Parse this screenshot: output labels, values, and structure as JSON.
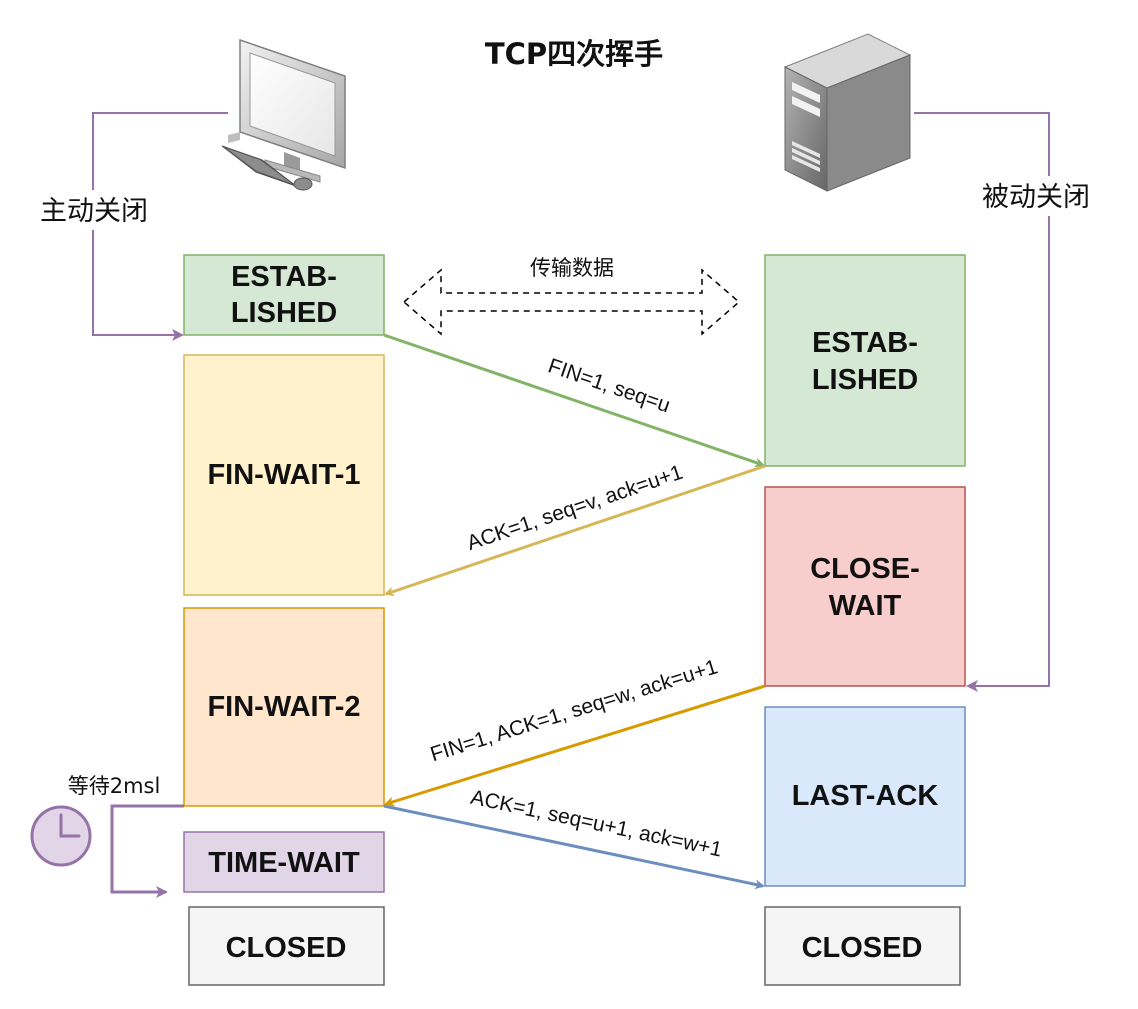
{
  "title": "TCP四次挥手",
  "left_side": {
    "label": "主动关闭",
    "icon": "desktop-computer-icon",
    "states": [
      {
        "id": "l-established",
        "line1": "ESTAB-",
        "line2": "LISHED",
        "fill": "#d5e8d4",
        "stroke": "#82b366"
      },
      {
        "id": "l-fin-wait-1",
        "line1": "FIN-WAIT-1",
        "fill": "#fff2cc",
        "stroke": "#d6b656"
      },
      {
        "id": "l-fin-wait-2",
        "line1": "FIN-WAIT-2",
        "fill": "#ffe6cc",
        "stroke": "#d79b00"
      },
      {
        "id": "l-time-wait",
        "line1": "TIME-WAIT",
        "fill": "#e1d5e7",
        "stroke": "#9673a6"
      },
      {
        "id": "l-closed",
        "line1": "CLOSED",
        "fill": "#f5f5f5",
        "stroke": "#666666"
      }
    ],
    "wait_label": "等待2msl",
    "wait_icon": "clock-icon"
  },
  "right_side": {
    "label": "被动关闭",
    "icon": "server-tower-icon",
    "states": [
      {
        "id": "r-established",
        "line1": "ESTAB-",
        "line2": "LISHED",
        "fill": "#d5e8d4",
        "stroke": "#82b366"
      },
      {
        "id": "r-close-wait",
        "line1": "CLOSE-",
        "line2": "WAIT",
        "fill": "#f8cecc",
        "stroke": "#b85450"
      },
      {
        "id": "r-last-ack",
        "line1": "LAST-ACK",
        "fill": "#dae8fc",
        "stroke": "#6c8ebf"
      },
      {
        "id": "r-closed",
        "line1": "CLOSED",
        "fill": "#f5f5f5",
        "stroke": "#666666"
      }
    ]
  },
  "data_transfer_label": "传输数据",
  "messages": [
    {
      "id": "msg-fin-1",
      "label": "FIN=1, seq=u",
      "color": "#82b366"
    },
    {
      "id": "msg-ack-1",
      "label": "ACK=1, seq=v, ack=u+1",
      "color": "#d6b656"
    },
    {
      "id": "msg-fin-2",
      "label": "FIN=1, ACK=1, seq=w, ack=u+1",
      "color": "#d79b00"
    },
    {
      "id": "msg-ack-2",
      "label": "ACK=1, seq=u+1, ack=w+1",
      "color": "#6c8ebf"
    }
  ],
  "connector_color": "#9673a6"
}
